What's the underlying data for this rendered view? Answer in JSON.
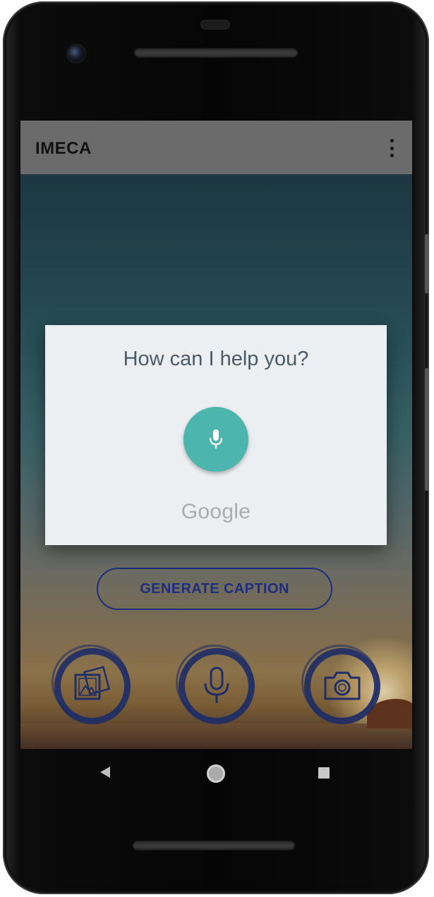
{
  "app_bar": {
    "title": "IMECA",
    "menu_icon": "more-vert-icon"
  },
  "dialog": {
    "prompt": "How can I help you?",
    "mic_icon": "mic-icon",
    "brand": "Google",
    "mic_color": "#4db6ac"
  },
  "main": {
    "generate_caption_label": "GENERATE CAPTION",
    "accent_color": "#1f2e7a",
    "actions": [
      {
        "name": "gallery",
        "icon": "gallery-icon"
      },
      {
        "name": "voice",
        "icon": "mic-icon"
      },
      {
        "name": "camera",
        "icon": "camera-icon"
      }
    ]
  },
  "navigation_bar": {
    "back_icon": "back-icon",
    "home_icon": "home-icon",
    "recents_icon": "recents-icon"
  }
}
